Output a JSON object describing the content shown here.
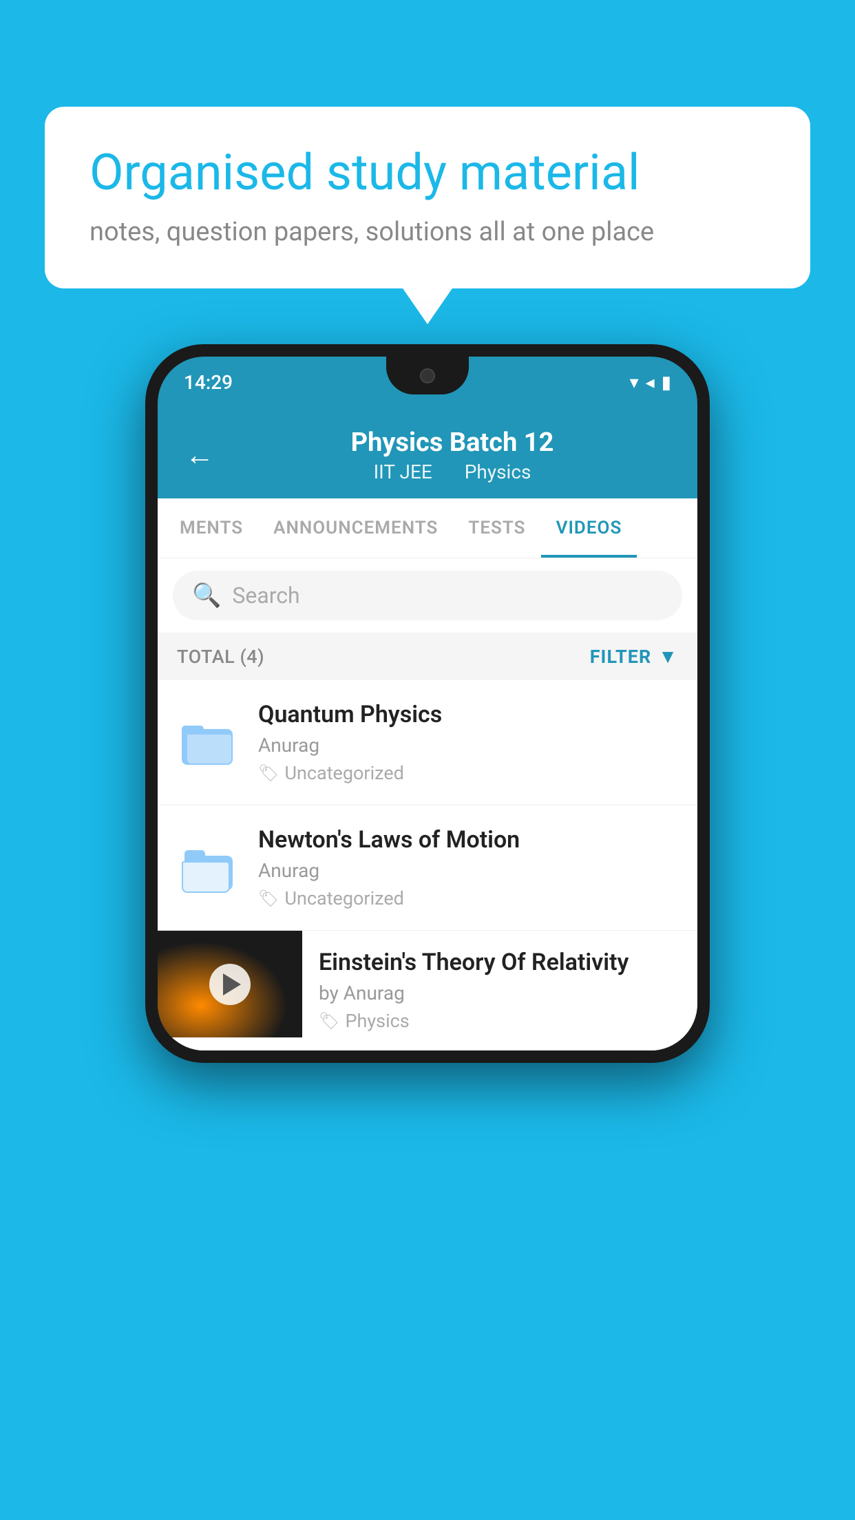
{
  "background_color": "#1bb8e8",
  "speech_bubble": {
    "title": "Organised study material",
    "subtitle": "notes, question papers, solutions all at one place"
  },
  "phone": {
    "status_bar": {
      "time": "14:29"
    },
    "header": {
      "title": "Physics Batch 12",
      "subtitle_part1": "IIT JEE",
      "subtitle_part2": "Physics",
      "back_label": "←"
    },
    "tabs": [
      {
        "label": "MENTS",
        "active": false
      },
      {
        "label": "ANNOUNCEMENTS",
        "active": false
      },
      {
        "label": "TESTS",
        "active": false
      },
      {
        "label": "VIDEOS",
        "active": true
      }
    ],
    "search": {
      "placeholder": "Search"
    },
    "total_bar": {
      "label": "TOTAL (4)",
      "filter_label": "FILTER"
    },
    "videos": [
      {
        "title": "Quantum Physics",
        "author": "Anurag",
        "tag": "Uncategorized",
        "has_thumbnail": false
      },
      {
        "title": "Newton's Laws of Motion",
        "author": "Anurag",
        "tag": "Uncategorized",
        "has_thumbnail": false
      },
      {
        "title": "Einstein's Theory Of Relativity",
        "author": "by Anurag",
        "tag": "Physics",
        "has_thumbnail": true
      }
    ]
  }
}
